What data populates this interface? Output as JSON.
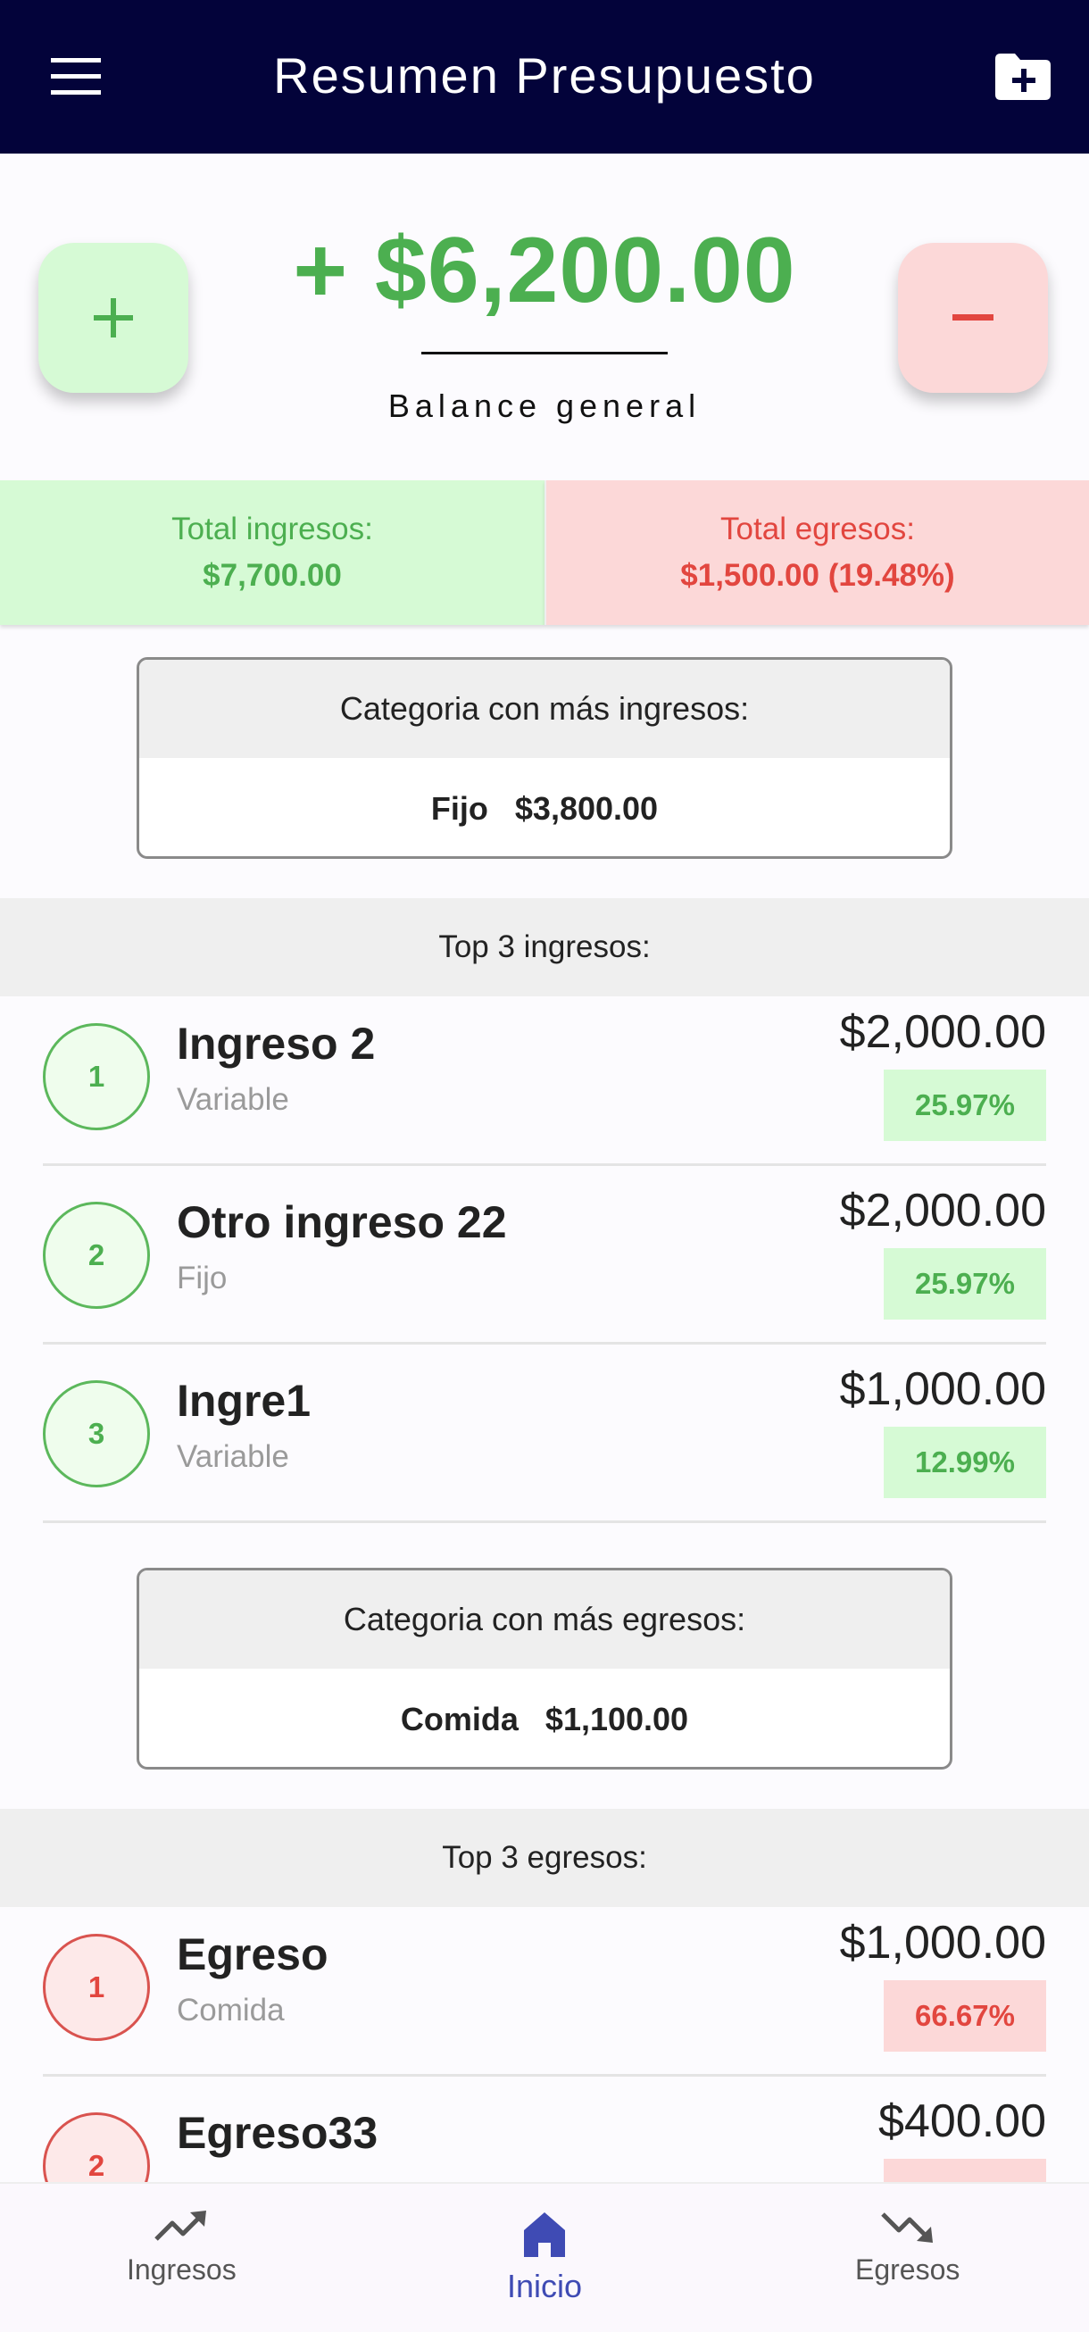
{
  "appbar": {
    "title": "Resumen Presupuesto",
    "menu_icon": "menu-icon",
    "folder_icon": "folder-add-icon"
  },
  "balance": {
    "amount": "+ $6,200.00",
    "label": "Balance general",
    "add_icon": "plus-icon",
    "subtract_icon": "minus-icon"
  },
  "totals": {
    "income_label": "Total ingresos:",
    "income_value": "$7,700.00",
    "expense_label": "Total egresos:",
    "expense_value": "$1,500.00 (19.48%)"
  },
  "top_income_category": {
    "title": "Categoria con más ingresos:",
    "name": "Fijo",
    "amount": "$3,800.00"
  },
  "top_income": {
    "title": "Top 3 ingresos:",
    "items": [
      {
        "rank": "1",
        "name": "Ingreso 2",
        "category": "Variable",
        "amount": "$2,000.00",
        "percent": "25.97%"
      },
      {
        "rank": "2",
        "name": "Otro ingreso 22",
        "category": "Fijo",
        "amount": "$2,000.00",
        "percent": "25.97%"
      },
      {
        "rank": "3",
        "name": "Ingre1",
        "category": "Variable",
        "amount": "$1,000.00",
        "percent": "12.99%"
      }
    ]
  },
  "top_expense_category": {
    "title": "Categoria con más egresos:",
    "name": "Comida",
    "amount": "$1,100.00"
  },
  "top_expense": {
    "title": "Top 3 egresos:",
    "items": [
      {
        "rank": "1",
        "name": "Egreso",
        "category": "Comida",
        "amount": "$1,000.00",
        "percent": "66.67%"
      },
      {
        "rank": "2",
        "name": "Egreso33",
        "category": "",
        "amount": "$400.00",
        "percent": ""
      }
    ]
  },
  "colors": {
    "appbar": "#03033a",
    "income": "#4caf50",
    "expense": "#e2463f",
    "active_nav": "#3f4bb4"
  },
  "nav": {
    "items": [
      {
        "label": "Ingresos",
        "icon": "trending-up-icon"
      },
      {
        "label": "Inicio",
        "icon": "home-icon"
      },
      {
        "label": "Egresos",
        "icon": "trending-down-icon"
      }
    ]
  }
}
